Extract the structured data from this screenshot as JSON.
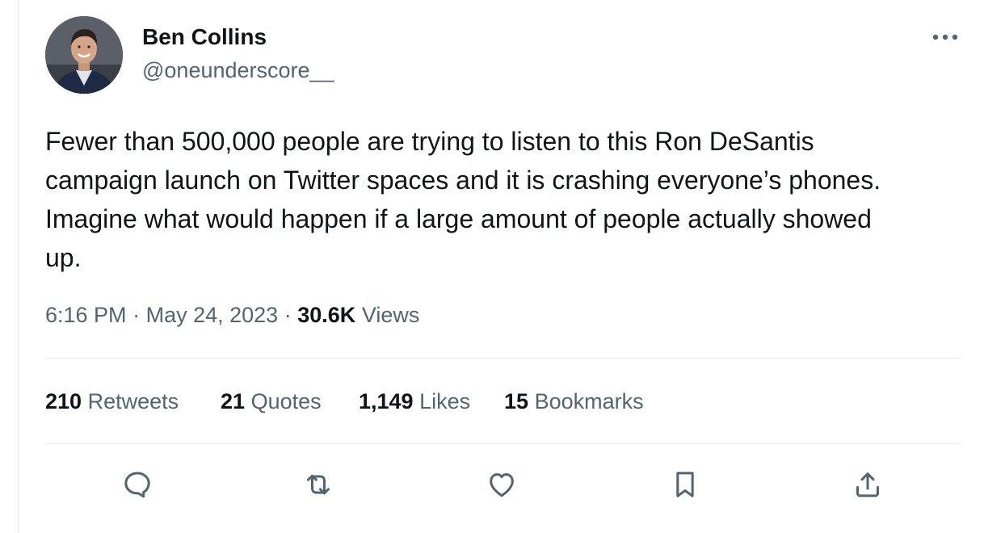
{
  "author": {
    "display_name": "Ben Collins",
    "handle": "@oneunderscore__",
    "avatar_icon": "profile-photo"
  },
  "tweet": {
    "text_lines": [
      "Fewer than 500,000 people are trying to listen to this Ron DeSantis",
      "campaign launch on Twitter spaces and it is crashing everyone’s phones.",
      "Imagine what would happen if a large amount of people actually showed",
      "up."
    ],
    "time": "6:16 PM",
    "separator": "·",
    "date": "May 24, 2023",
    "views_count": "30.6K",
    "views_label": "Views"
  },
  "stats": [
    {
      "count": "210",
      "label": "Retweets"
    },
    {
      "count": "21",
      "label": "Quotes"
    },
    {
      "count": "1,149",
      "label": "Likes"
    },
    {
      "count": "15",
      "label": "Bookmarks"
    }
  ],
  "actions": [
    "reply-icon",
    "retweet-icon",
    "like-icon",
    "bookmark-icon",
    "share-icon"
  ],
  "colors": {
    "primary_text": "#0f1419",
    "secondary_text": "#536471",
    "divider": "#e4eaee"
  }
}
